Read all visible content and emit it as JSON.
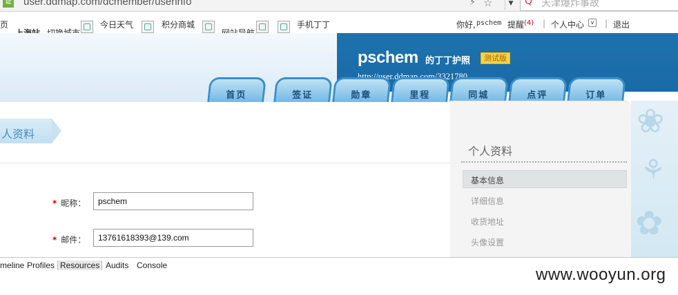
{
  "browser": {
    "url": "user.ddmap.com/dcmember/userinfo",
    "search_text": "天津爆炸事故"
  },
  "topnav": {
    "partial_left": "页",
    "city": "上海站",
    "switch_city": "切换城市",
    "weather": "今日天气",
    "points_mall": "积分商城",
    "site_nav": "网站导航",
    "mobile": "手机丁丁",
    "greeting": "你好,",
    "user": "pschem",
    "reminder": "提醒",
    "reminder_count": "(4)",
    "user_center": "个人中心",
    "logout": "退出",
    "sep": "|"
  },
  "header": {
    "username": "pschem",
    "passport_label": "的丁丁护照",
    "beta_badge": "测试版",
    "homepage_url": "http://user.ddmap.com/3321780"
  },
  "tabs": [
    "首页",
    "签证",
    "勋章",
    "里程",
    "同城",
    "点评",
    "订单"
  ],
  "content": {
    "breadcrumb": "人资料",
    "fields": [
      {
        "label": "昵称：",
        "required": "*",
        "value": "pschem"
      },
      {
        "label": "邮件：",
        "required": "*",
        "value": "13761618393@139.com"
      }
    ]
  },
  "sidebar": {
    "title": "个人资料",
    "items": [
      "基本信息",
      "详细信息",
      "收货地址",
      "头像设置"
    ]
  },
  "devtools": {
    "tabs": [
      "meline",
      "Profiles",
      "Resources",
      "Audits",
      "Console"
    ]
  },
  "watermark": "www.wooyun.org",
  "colors": {
    "header_blue": "#1d72ad",
    "tab_border": "#3b8fcb",
    "required_red": "#cc0000",
    "beta_yellow": "#f2d64a"
  }
}
